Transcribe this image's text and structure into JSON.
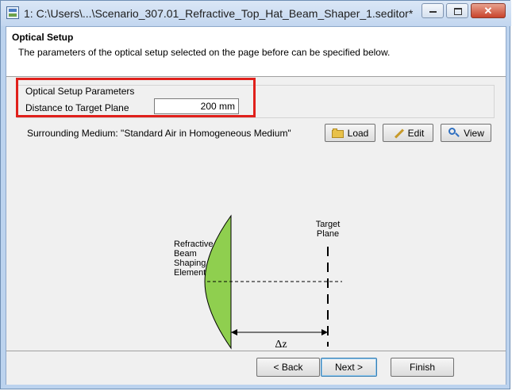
{
  "window": {
    "title": "1: C:\\Users\\...\\Scenario_307.01_Refractive_Top_Hat_Beam_Shaper_1.seditor*",
    "close_glyph": "✕"
  },
  "header": {
    "title": "Optical Setup",
    "description": "The parameters of the optical setup selected on the page before can be specified below."
  },
  "params": {
    "group_label": "Optical Setup Parameters",
    "distance_label": "Distance to Target Plane",
    "distance_value": "200 mm",
    "medium_text": "Surrounding Medium: \"Standard Air in Homogeneous Medium\"",
    "load_label": "Load",
    "edit_label": "Edit",
    "view_label": "View"
  },
  "diagram": {
    "element_label": [
      "Refractive",
      "Beam",
      "Shaping",
      "Element"
    ],
    "target_label": [
      "Target",
      "Plane"
    ],
    "delta_label": "Δz",
    "element_color": "#8fcf4f"
  },
  "footer": {
    "back_label": "< Back",
    "next_label": "Next >",
    "finish_label": "Finish"
  },
  "colors": {
    "highlight": "#e0201b"
  }
}
